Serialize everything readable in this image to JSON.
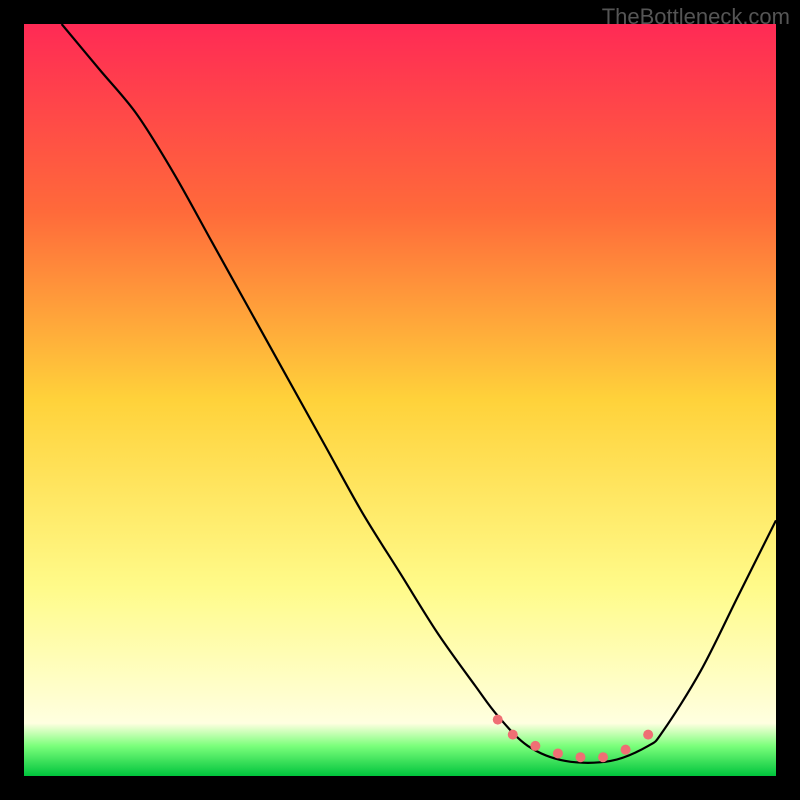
{
  "watermark": "TheBottleneck.com",
  "chart_data": {
    "type": "line",
    "title": "",
    "xlabel": "",
    "ylabel": "",
    "xlim": [
      0,
      100
    ],
    "ylim": [
      0,
      100
    ],
    "background_gradient": {
      "stops": [
        {
          "offset": 0,
          "color": "#ff2a55"
        },
        {
          "offset": 25,
          "color": "#ff6a3a"
        },
        {
          "offset": 50,
          "color": "#ffd23a"
        },
        {
          "offset": 75,
          "color": "#fffb8a"
        },
        {
          "offset": 93,
          "color": "#ffffe0"
        },
        {
          "offset": 96,
          "color": "#7bff7b"
        },
        {
          "offset": 100,
          "color": "#00c43c"
        }
      ]
    },
    "series": [
      {
        "name": "bottleneck-curve",
        "color": "#000000",
        "x": [
          5,
          10,
          15,
          20,
          25,
          30,
          35,
          40,
          45,
          50,
          55,
          60,
          63,
          67,
          72,
          78,
          83,
          85,
          90,
          95,
          100
        ],
        "y": [
          100,
          94,
          88,
          80,
          71,
          62,
          53,
          44,
          35,
          27,
          19,
          12,
          8,
          4,
          2,
          2,
          4,
          6,
          14,
          24,
          34
        ]
      }
    ],
    "markers": {
      "name": "optimal-range",
      "color": "#ef6f74",
      "radius": 5,
      "x": [
        63,
        65,
        68,
        71,
        74,
        77,
        80,
        83
      ],
      "y": [
        7.5,
        5.5,
        4,
        3,
        2.5,
        2.5,
        3.5,
        5.5
      ]
    }
  }
}
